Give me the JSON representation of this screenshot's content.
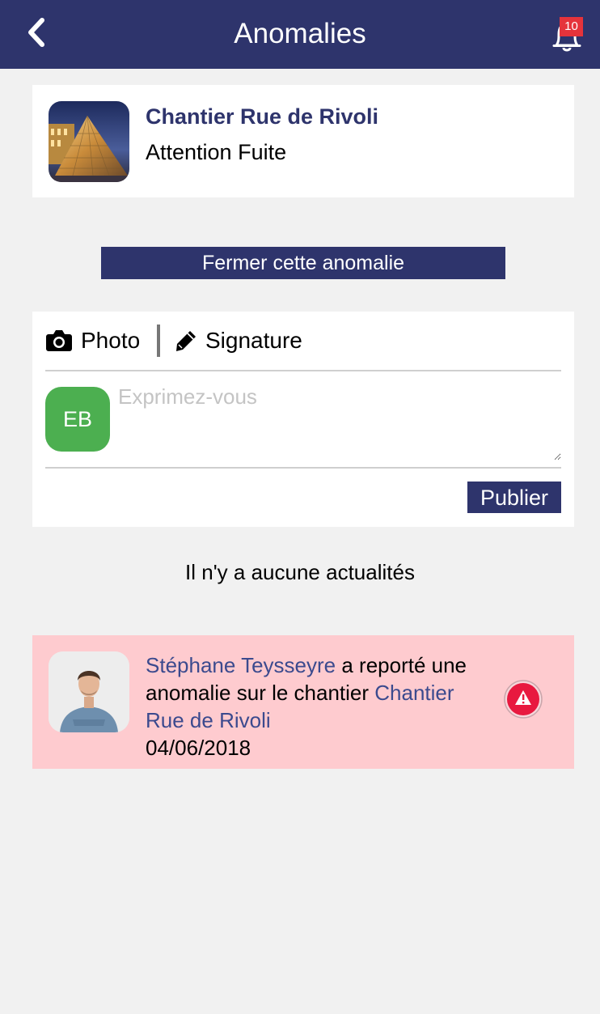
{
  "header": {
    "title": "Anomalies",
    "notification_count": "10"
  },
  "project": {
    "name": "Chantier Rue de Rivoli",
    "subtitle": "Attention Fuite"
  },
  "actions": {
    "close_anomaly_label": "Fermer cette anomalie"
  },
  "composer": {
    "photo_label": "Photo",
    "signature_label": "Signature",
    "user_initials": "EB",
    "placeholder": "Exprimez-vous",
    "publish_label": "Publier"
  },
  "feed": {
    "empty_message": "Il n'y a aucune actualités"
  },
  "notification": {
    "author": "Stéphane Teysseyre",
    "text_part1": " a reporté une anomalie sur le chantier ",
    "project_link": "Chantier Rue de Rivoli",
    "date": "04/06/2018"
  },
  "colors": {
    "brand": "#2e346c",
    "badge": "#e5333b",
    "avatar_green": "#4caf50",
    "alert_bg": "#fecbcf",
    "alert_icon": "#e8193f"
  },
  "icons": {
    "back": "chevron-left-icon",
    "notifications": "bell-icon",
    "photo": "camera-icon",
    "signature": "pencil-icon",
    "alert": "warning-icon"
  }
}
